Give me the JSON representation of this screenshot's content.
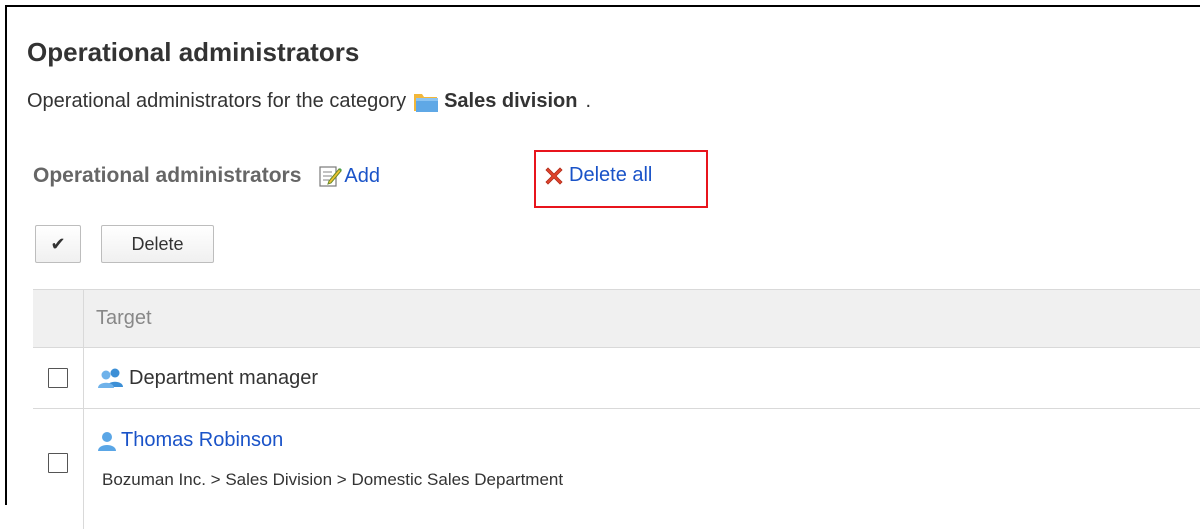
{
  "page": {
    "title": "Operational administrators",
    "description_prefix": "Operational administrators for the category",
    "category_name": "Sales division",
    "description_suffix": "."
  },
  "section": {
    "label": "Operational administrators",
    "add_label": "Add",
    "delete_all_label": "Delete all"
  },
  "toolbar": {
    "check_all_label": "✔",
    "delete_label": "Delete"
  },
  "table": {
    "header": "Target",
    "rows": [
      {
        "type": "role",
        "name": "Department manager"
      },
      {
        "type": "user",
        "name": "Thomas Robinson",
        "path": "Bozuman Inc. > Sales Division > Domestic Sales Department"
      }
    ]
  },
  "colors": {
    "link": "#1a53c8",
    "highlight_box": "#e8141c",
    "header_bg": "#f0f0f0"
  },
  "icons": {
    "category": "folder-icon",
    "add": "edit-note-icon",
    "delete_all": "red-x-icon",
    "role": "group-icon",
    "user": "user-icon"
  }
}
